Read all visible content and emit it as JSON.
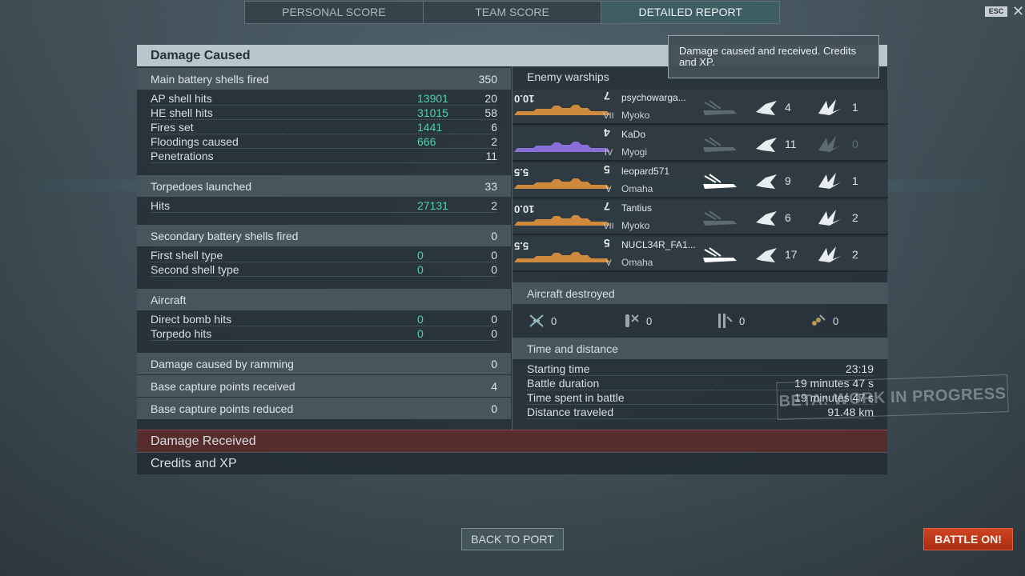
{
  "tabs": [
    "PERSONAL SCORE",
    "TEAM SCORE",
    "DETAILED REPORT"
  ],
  "esc_label": "ESC",
  "close_glyph": "✕",
  "tooltip": "Damage caused and received. Credits and XP.",
  "panel_title": "Damage Caused",
  "main_battery": {
    "label": "Main battery shells fired",
    "value": "350",
    "rows": [
      {
        "label": "AP shell hits",
        "damage": "13901",
        "count": "20"
      },
      {
        "label": "HE shell hits",
        "damage": "31015",
        "count": "58"
      },
      {
        "label": "Fires set",
        "damage": "1441",
        "count": "6"
      },
      {
        "label": "Floodings caused",
        "damage": "666",
        "count": "2"
      },
      {
        "label": "Penetrations",
        "damage": "",
        "count": "11"
      }
    ]
  },
  "torpedoes": {
    "label": "Torpedoes launched",
    "value": "33",
    "rows": [
      {
        "label": "Hits",
        "damage": "27131",
        "count": "2"
      }
    ]
  },
  "secondary": {
    "label": "Secondary battery shells fired",
    "value": "0",
    "rows": [
      {
        "label": "First shell type",
        "damage": "0",
        "count": "0"
      },
      {
        "label": "Second shell type",
        "damage": "0",
        "count": "0"
      }
    ]
  },
  "aircraft": {
    "label": "Aircraft",
    "rows": [
      {
        "label": "Direct bomb hits",
        "damage": "0",
        "count": "0"
      },
      {
        "label": "Torpedo hits",
        "damage": "0",
        "count": "0"
      }
    ]
  },
  "ramming": {
    "label": "Damage caused by ramming",
    "value": "0"
  },
  "base_received": {
    "label": "Base capture points received",
    "value": "4"
  },
  "base_reduced": {
    "label": "Base capture points reduced",
    "value": "0"
  },
  "enemy_title": "Enemy warships",
  "enemies": [
    {
      "badge": "10.0",
      "tier_num": "7",
      "roman": "VII",
      "player": "psychowarga...",
      "ship": "Myoko",
      "sil_color": "#d08a3e",
      "destroyed": false,
      "hits": "4",
      "crit": "1",
      "crit_dim": false
    },
    {
      "badge": "",
      "tier_num": "4",
      "roman": "IV",
      "player": "KaDo",
      "ship": "Myogi",
      "sil_color": "#8a6fd9",
      "destroyed": false,
      "hits": "11",
      "crit": "0",
      "crit_dim": true
    },
    {
      "badge": "5.5",
      "tier_num": "5",
      "roman": "V",
      "player": "leopard571",
      "ship": "Omaha",
      "sil_color": "#d08a3e",
      "destroyed": true,
      "hits": "9",
      "crit": "1",
      "crit_dim": false
    },
    {
      "badge": "10.0",
      "tier_num": "7",
      "roman": "VII",
      "player": "Tantius",
      "ship": "Myoko",
      "sil_color": "#d08a3e",
      "destroyed": false,
      "hits": "6",
      "crit": "2",
      "crit_dim": false
    },
    {
      "badge": "5.5",
      "tier_num": "5",
      "roman": "V",
      "player": "NUCL34R_FA1...",
      "ship": "Omaha",
      "sil_color": "#d08a3e",
      "destroyed": true,
      "hits": "17",
      "crit": "2",
      "crit_dim": false
    }
  ],
  "aircraft_destroyed": {
    "title": "Aircraft destroyed",
    "items": [
      {
        "icon": "fighter-icon",
        "value": "0"
      },
      {
        "icon": "bomb-icon",
        "value": "0"
      },
      {
        "icon": "torpedo-bomber-icon",
        "value": "0"
      },
      {
        "icon": "dive-bomber-icon",
        "value": "0"
      }
    ]
  },
  "time_distance": {
    "title": "Time and distance",
    "rows": [
      {
        "label": "Starting time",
        "value": "23:19"
      },
      {
        "label": "Battle duration",
        "value": "19 minutes 47 s"
      },
      {
        "label": "Time spent in battle",
        "value": "19 minutes 47 s"
      },
      {
        "label": "Distance traveled",
        "value": "91.48 km"
      }
    ]
  },
  "damage_received_label": "Damage Received",
  "credits_xp_label": "Credits and XP",
  "watermark": "BETA: WORK IN PROGRESS",
  "back_label": "BACK TO PORT",
  "battle_label": "BATTLE ON!"
}
